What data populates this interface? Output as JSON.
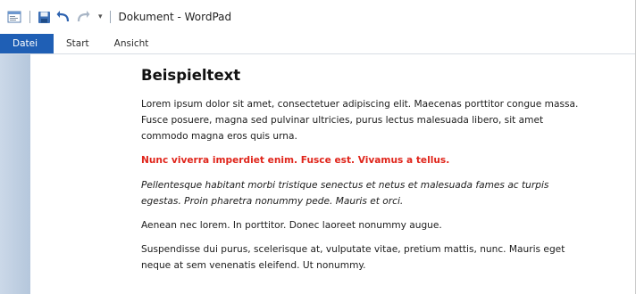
{
  "window": {
    "title": "Dokument - WordPad"
  },
  "quick_access": {
    "icons": [
      "wordpad-app-icon",
      "save-icon",
      "undo-icon",
      "redo-icon",
      "customize-dropdown-icon"
    ]
  },
  "ribbon": {
    "tabs": [
      {
        "label": "Datei",
        "active": true
      },
      {
        "label": "Start",
        "active": false
      },
      {
        "label": "Ansicht",
        "active": false
      }
    ]
  },
  "document": {
    "heading": "Beispieltext",
    "paragraphs": [
      {
        "lines": [
          "Lorem ipsum dolor sit amet, consectetuer adipiscing elit. Maecenas porttitor congue massa.",
          "Fusce posuere, magna sed pulvinar ultricies, purus lectus malesuada libero, sit amet",
          "commodo magna eros quis urna."
        ]
      },
      {
        "lines": [
          "Nunc viverra imperdiet enim. Fusce est. Vivamus a tellus."
        ],
        "color": "#e0251b"
      },
      {
        "lines": [
          "Pellentesque habitant morbi tristique senectus et netus et malesuada fames ac turpis",
          "egestas. Proin pharetra nonummy pede. Mauris et orci."
        ]
      },
      {
        "lines": [
          "Aenean nec lorem. In porttitor. Donec laoreet nonummy  augue."
        ]
      },
      {
        "lines": [
          "Suspendisse dui purus, scelerisque at, vulputate vitae, pretium  mattis, nunc. Mauris eget",
          "neque at sem venenatis eleifend. Ut nonummy."
        ]
      }
    ]
  },
  "colors": {
    "file_tab": "#1f5fb5",
    "highlight_text": "#e0251b"
  }
}
